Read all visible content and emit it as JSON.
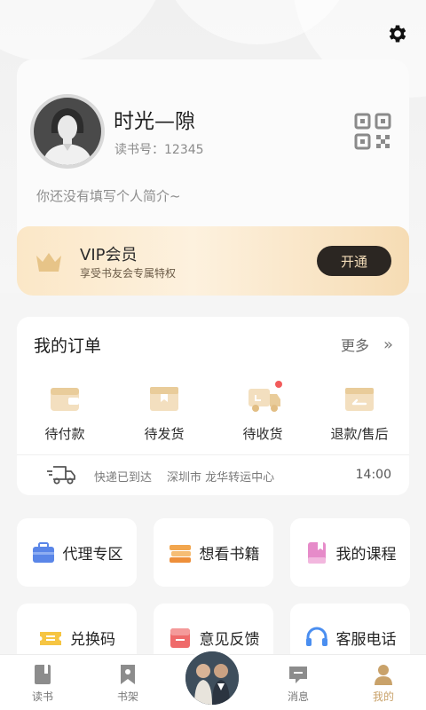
{
  "profile": {
    "name": "时光—隙",
    "id_text": "读书号：12345",
    "bio": "你还没有填写个人简介~"
  },
  "vip": {
    "title": "VIP会员",
    "subtitle": "享受书友会专属特权",
    "button": "开通"
  },
  "orders": {
    "title": "我的订单",
    "more": "更多",
    "more_arrow": "»",
    "items": [
      {
        "label": "待付款",
        "icon": "wallet-icon"
      },
      {
        "label": "待发货",
        "icon": "box-icon"
      },
      {
        "label": "待收货",
        "icon": "delivery-truck-icon"
      },
      {
        "label": "退款/售后",
        "icon": "refund-icon"
      }
    ],
    "tracking": {
      "status": "快递已到达",
      "location": "深圳市 龙华转运中心",
      "time": "14:00"
    }
  },
  "tiles": [
    {
      "label": "代理专区",
      "icon": "briefcase-icon"
    },
    {
      "label": "想看书籍",
      "icon": "books-icon"
    },
    {
      "label": "我的课程",
      "icon": "course-book-icon"
    },
    {
      "label": "兑换码",
      "icon": "coupon-icon"
    },
    {
      "label": "意见反馈",
      "icon": "feedback-icon"
    },
    {
      "label": "客服电话",
      "icon": "headset-icon"
    }
  ],
  "tabbar": {
    "items": [
      {
        "label": "读书",
        "icon": "book-icon"
      },
      {
        "label": "书架",
        "icon": "bookmark-icon"
      },
      {
        "label": "消息",
        "icon": "message-icon"
      },
      {
        "label": "我的",
        "icon": "person-icon",
        "active": true
      }
    ]
  },
  "colors": {
    "accent_gold": "#c9a26a",
    "vip_button_bg": "#2b2622",
    "badge_red": "#f25b5b"
  }
}
